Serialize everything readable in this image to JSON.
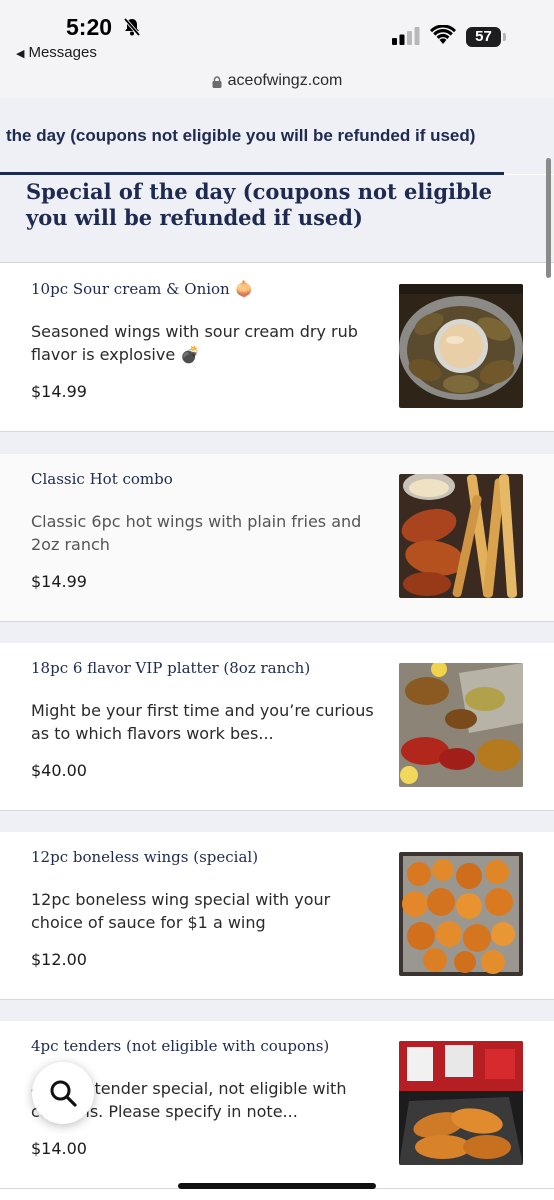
{
  "status_bar": {
    "time": "5:20",
    "back_label": "Messages",
    "battery": "57"
  },
  "browser": {
    "url": "aceofwingz.com"
  },
  "category_tab": {
    "label": "the day (coupons not eligible you will be refunded if used)"
  },
  "section": {
    "title": "Special of the day (coupons not eligible you will be refunded if used)"
  },
  "items": [
    {
      "name": "10pc Sour cream & Onion",
      "name_emoji": "🧅",
      "desc": "Seasoned wings with sour cream dry rub flavor is explosive 💣",
      "price": "$14.99",
      "image_icon": "wings-with-dip-photo"
    },
    {
      "name": "Classic Hot combo",
      "name_emoji": "",
      "desc": "Classic 6pc hot wings with plain fries and 2oz ranch",
      "price": "$14.99",
      "image_icon": "hot-wings-fries-photo"
    },
    {
      "name": "18pc 6 flavor VIP platter (8oz ranch)",
      "name_emoji": "",
      "desc": "Might be your first time and you’re curious as to which flavors work bes...",
      "price": "$40.00",
      "image_icon": "wing-platter-photo"
    },
    {
      "name": "12pc boneless wings (special)",
      "name_emoji": "",
      "desc": "12pc boneless wing special with your choice of sauce for $1 a wing",
      "price": "$12.00",
      "image_icon": "boneless-wings-photo"
    },
    {
      "name": "4pc tenders (not eligible with coupons)",
      "name_emoji": "",
      "desc": "4 piece tender special, not eligible with coupons. Please specify in note...",
      "price": "$14.00",
      "image_icon": "tenders-photo"
    }
  ],
  "colors": {
    "navy": "#1e2a50",
    "section_bg": "#eef0f5"
  }
}
